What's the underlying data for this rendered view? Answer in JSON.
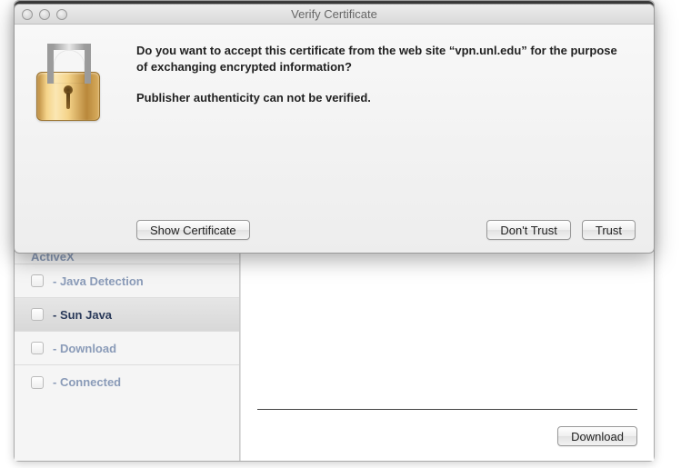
{
  "dialog": {
    "title": "Verify Certificate",
    "message": "Do you want to accept this certificate from the web site “vpn.unl.edu” for the purpose of exchanging encrypted information?",
    "sub_message": "Publisher authenticity can not be verified.",
    "buttons": {
      "show_cert": "Show Certificate",
      "dont_trust": "Don't Trust",
      "trust": "Trust"
    }
  },
  "back_window": {
    "sidebar": {
      "items": [
        {
          "label": "ActiveX",
          "partial": true
        },
        {
          "label": "- Java Detection"
        },
        {
          "label": "- Sun Java",
          "selected": true
        },
        {
          "label": "- Download"
        },
        {
          "label": "- Connected"
        }
      ]
    },
    "main": {
      "download_label": "Download"
    }
  }
}
